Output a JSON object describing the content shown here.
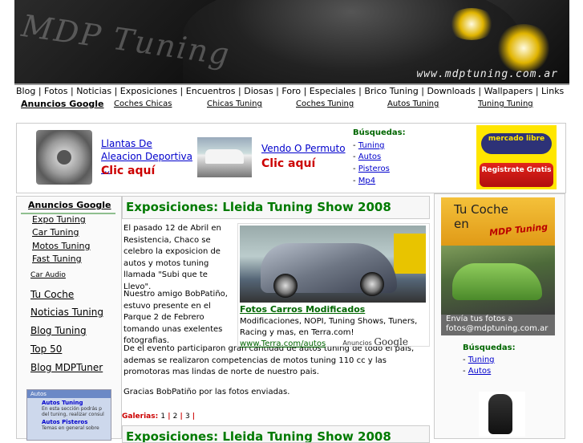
{
  "banner": {
    "logo_text": "MDP Tuning",
    "url": "www.mdptuning.com.ar"
  },
  "topnav": [
    "Blog",
    "Fotos",
    "Noticias",
    "Exposiciones",
    "Encuentros",
    "Diosas",
    "Foro",
    "Especiales",
    "Brico Tuning",
    "Downloads",
    "Wallpapers",
    "Links"
  ],
  "subnav": {
    "anuncios": "Anuncios Google",
    "links": [
      "Coches Chicas",
      "Chicas Tuning",
      "Coches Tuning",
      "Autos Tuning",
      "Tuning Tuning"
    ]
  },
  "ad_strip": {
    "ad1": {
      "title": "Llantas De Aleacion Deportiva ...",
      "cta": "Clic aquí"
    },
    "ad2": {
      "title": "Vendo O Permuto",
      "cta": "Clic aquí"
    },
    "busquedas": {
      "title": "Búsquedas:",
      "items": [
        "Tuning",
        "Autos",
        "Pisteros",
        "Mp4"
      ]
    },
    "mercadolibre": {
      "logo": "mercado libre",
      "button": "Registrate Gratis"
    }
  },
  "left_col": {
    "anuncios": "Anuncios Google",
    "ad_links": [
      "Expo Tuning",
      "Car Tuning",
      "Motos Tuning",
      "Fast Tuning"
    ],
    "links": [
      "Car Audio",
      "Tu Coche",
      "Noticias Tuning",
      "Blog Tuning",
      "Top 50",
      "Blog MDPTuner"
    ],
    "thumb": {
      "header": "Autos",
      "t1": "Autos Tuning",
      "t2": "En esta sección podrás p del tuning, realizar consul",
      "t3": "Autos Pisteros",
      "t4": "Temas en general sobre"
    }
  },
  "main": {
    "title": "Exposiciones: Lleida Tuning Show 2008",
    "p1": "El pasado 12 de Abril en Resistencia, Chaco se celebro la exposicion de autos y motos tuning llamada \"Subi que te Llevo\".",
    "p2": "Nuestro amigo BobPatiño, estuvo presente en el Parque 2 de Febrero tomando unas exelentes fotografias.",
    "p3": "De el evento participaron gran cantidad de autos tuning de todo el pais, ademas se realizaron competencias de motos tuning 110 cc y las promotoras mas lindas de norte de nuestro pais.",
    "p4": "Gracias BobPatiño por las fotos enviadas.",
    "photo_ad": {
      "caption": "Fotos Carros Modificados",
      "desc": "Modificaciones, NOPI, Tuning Shows, Tuners, Racing y mas, en Terra.com!",
      "url": "www.Terra.com/autos",
      "gads_label": "Anuncios",
      "gads_brand": "Google"
    },
    "galerias": {
      "label": "Galerias:",
      "pages": [
        "1",
        "2",
        "3"
      ]
    },
    "title2": "Exposiciones: Lleida Tuning Show 2008"
  },
  "right_col": {
    "tucoche": {
      "line1": "Tu Coche",
      "line2": "en",
      "brand": "MDP Tuning",
      "send1": "Envía tus fotos a",
      "send2": "fotos@mdptuning.com.ar"
    },
    "busquedas": {
      "title": "Búsquedas:",
      "items": [
        "Tuning",
        "Autos"
      ]
    }
  },
  "colors": {
    "title_green": "#007a00",
    "cta_red": "#cc0000",
    "link_blue": "#0000cc",
    "ml_yellow": "#ffe600"
  }
}
